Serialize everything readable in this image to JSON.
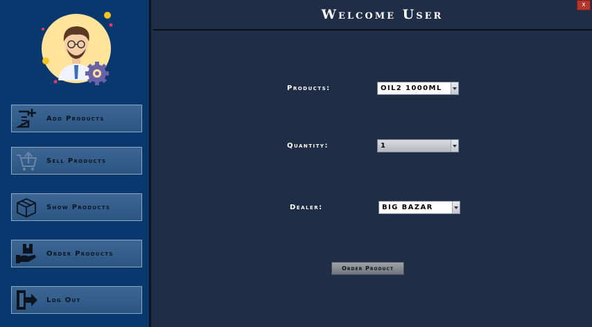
{
  "window": {
    "close_label": "x"
  },
  "header": {
    "title": "Welcome User"
  },
  "sidebar": {
    "items": [
      {
        "label": "Add Products",
        "icon": "add-document-icon"
      },
      {
        "label": "Sell Products",
        "icon": "cart-upload-icon"
      },
      {
        "label": "Show Products",
        "icon": "box-icon"
      },
      {
        "label": "Order Products",
        "icon": "hand-package-icon"
      },
      {
        "label": "Log Out",
        "icon": "logout-door-icon"
      }
    ]
  },
  "form": {
    "products": {
      "label": "Products:",
      "value": "OIL2 1000ML"
    },
    "quantity": {
      "label": "Quantity:",
      "value": "1"
    },
    "dealer": {
      "label": "Dealer:",
      "value": "BIG BAZAR"
    },
    "order_button": "Order Product"
  },
  "colors": {
    "sidebar_bg": "#08386e",
    "main_bg": "#1f2d47",
    "button_bg": "#2b5683",
    "close_button": "#b4372f"
  }
}
